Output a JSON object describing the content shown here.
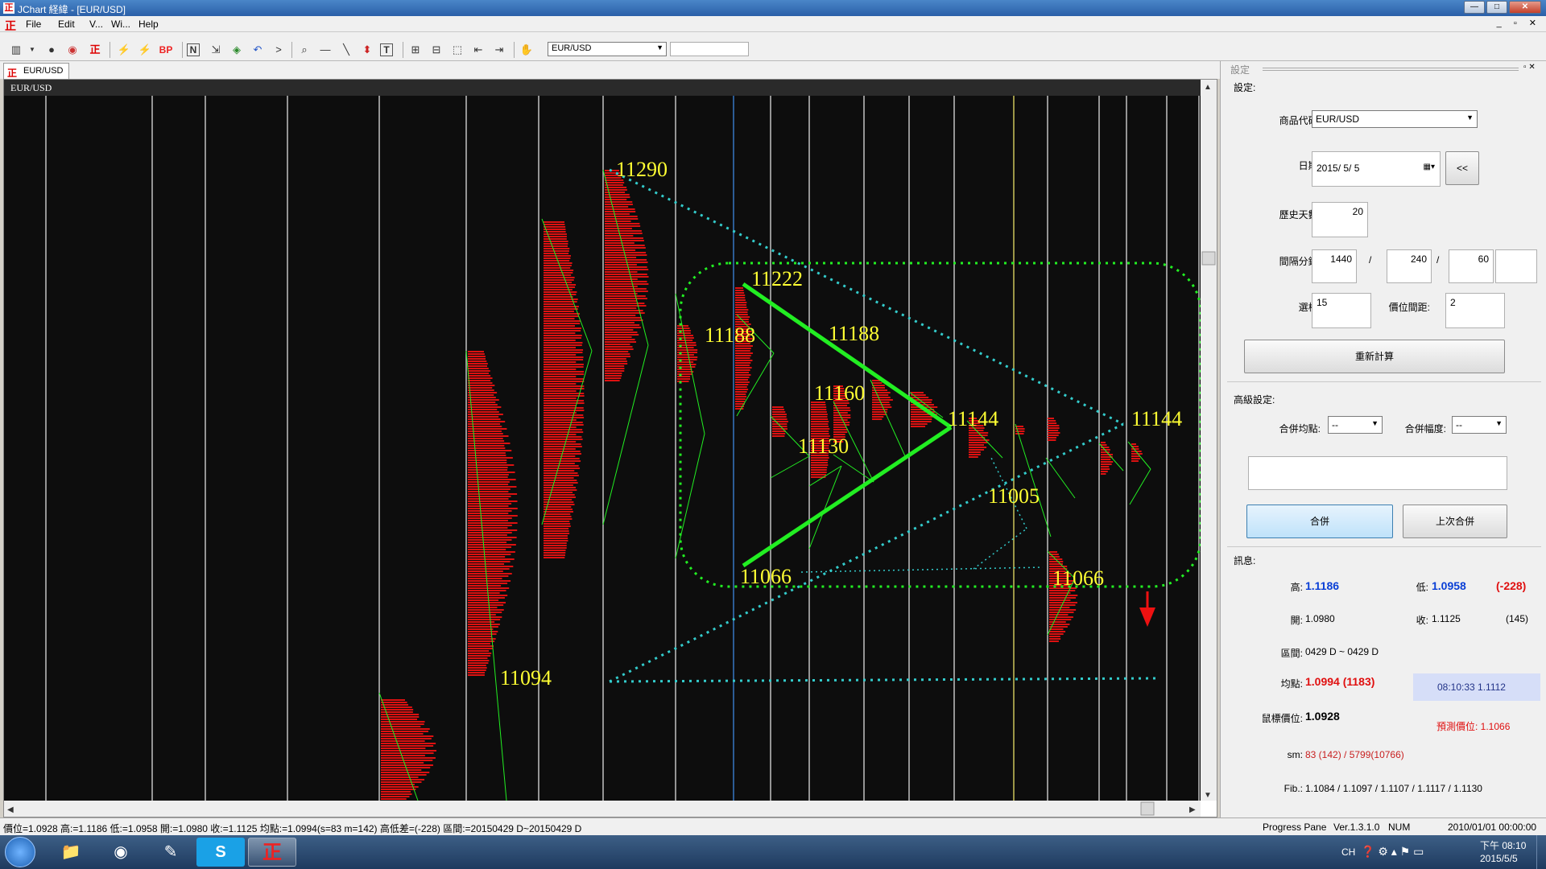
{
  "window": {
    "title": "JChart 経緯 - [EUR/USD]",
    "btn_min": "—",
    "btn_max": "□",
    "btn_close": "✕"
  },
  "menu": {
    "items": [
      "File",
      "Edit",
      "V...",
      "Wi...",
      "Help"
    ],
    "mdi": "_ ▫ ✕"
  },
  "toolbar": {
    "symbol": "EUR/USD",
    "bp_label": "BP",
    "n_label": "N",
    "t_label": "T"
  },
  "tab": {
    "label": "EUR/USD"
  },
  "chart": {
    "header_label": "EUR/USD",
    "price_labels": [
      {
        "text": "11290"
      },
      {
        "text": "11222"
      },
      {
        "text": "11188"
      },
      {
        "text": "11188"
      },
      {
        "text": "11160"
      },
      {
        "text": "11130"
      },
      {
        "text": "11144"
      },
      {
        "text": "11144"
      },
      {
        "text": "11005"
      },
      {
        "text": "11066"
      },
      {
        "text": "11066"
      },
      {
        "text": "11094"
      }
    ],
    "colors": {
      "background": "#0d0d0d",
      "profile": "#dd1111",
      "label": "#ffff33",
      "trend": "#22ee22",
      "dotted": "#33cccc",
      "arrow": "#ee1111"
    }
  },
  "panel": {
    "header": "設定",
    "settings_label": "設定:",
    "symbol_label": "商品代碼:",
    "symbol_value": "EUR/USD",
    "date_label": "日期:",
    "date_value": "2015/ 5/ 5",
    "back_btn": "<<",
    "days_label": "歷史天數:",
    "days_value": "20",
    "interval_label": "間隔分鐘:",
    "interval_1": "1440",
    "interval_2": "240",
    "interval_3": "60",
    "slash": "/",
    "choice_label": "選樣:",
    "choice_value": "15",
    "gap_label": "價位間距:",
    "gap_value": "2",
    "recalc_btn": "重新計算",
    "advanced_label": "高級設定:",
    "merge_avg_label": "合併均點:",
    "merge_avg_value": "--",
    "merge_width_label": "合併幅度:",
    "merge_width_value": "--",
    "merge_btn": "合併",
    "last_merge_btn": "上次合併",
    "info_label": "訊息:",
    "high_label": "高:",
    "high_value": "1.1186",
    "low_label": "低:",
    "low_value": "1.0958",
    "range_diff": "(-228)",
    "open_label": "開:",
    "open_value": "1.0980",
    "close_label": "收:",
    "close_value": "1.1125",
    "close_count": "(145)",
    "interval_range_label": "區間:",
    "interval_range_value": "0429 D ~ 0429 D",
    "avg_label": "均點:",
    "avg_value": "1.0994 (1183)",
    "time_price": "08:10:33  1.1112",
    "mouse_label": "鼠標價位:",
    "mouse_value": "1.0928",
    "forecast": "預測價位: 1.1066",
    "sm_label": "sm:",
    "sm_value": "83 (142) / 5799(10766)",
    "fib_label": "Fib.:",
    "fib_value": "1.1084 / 1.1097 / 1.1107 / 1.1117 / 1.1130",
    "colors": {
      "blue": "#0a3fd6",
      "red": "#e01010",
      "highlight": "#d6def8"
    }
  },
  "status": {
    "left": "價位=1.0928  高:=1.1186  低:=1.0958  開:=1.0980  收:=1.1125  均點:=1.0994(s=83 m=142)  高低差=(-228)  區間:=20150429 D~20150429 D",
    "progress": "Progress Pane",
    "version": "Ver.1.3.1.0",
    "num": "NUM",
    "datetime": "2010/01/01 00:00:00"
  },
  "taskbar": {
    "lang": "CH",
    "time": "下午 08:10",
    "date": "2015/5/5",
    "app_skype": "S",
    "app_jchart": "正"
  }
}
